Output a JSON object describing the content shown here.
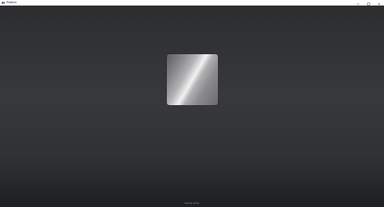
{
  "window": {
    "title": "Roblox",
    "controls": {
      "minimize_icon": "minimize-icon",
      "maximize_icon": "maximize-icon",
      "close_icon": "close-icon"
    }
  },
  "splash": {
    "logo_icon": "roblox-logo-tile",
    "status_text": "Joining server"
  },
  "colors": {
    "background_top": "#2c2d2f",
    "background_mid": "#38393c",
    "background_bottom": "#1e1f21",
    "tile_highlight": "#f2f2f2",
    "tile_base": "#6a6a6c",
    "titlebar": "#ffffff"
  }
}
